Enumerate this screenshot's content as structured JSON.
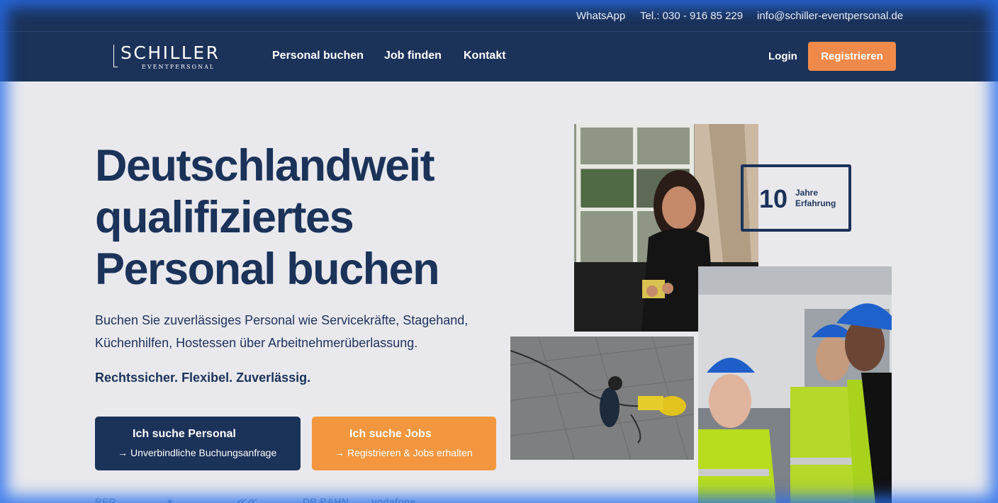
{
  "topbar": {
    "whatsapp": "WhatsApp",
    "phone": "Tel.: 030 - 916 85 229",
    "email": "info@schiller-eventpersonal.de"
  },
  "logo": {
    "main": "SCHILLER",
    "sub": "EVENTPERSONAL"
  },
  "nav": {
    "links": [
      "Personal buchen",
      "Job finden",
      "Kontakt"
    ],
    "login": "Login",
    "register": "Registrieren"
  },
  "hero": {
    "title_lines": [
      "Deutschlandweit",
      "qualifiziertes",
      "Personal buchen"
    ],
    "description": "Buchen Sie zuverlässiges Personal wie Servicekräfte, Stagehand, Küchenhilfen, Hostessen über Arbeitnehmerüberlassung.",
    "tagline": "Rechtssicher. Flexibel. Zuverlässig.",
    "cta_personal": {
      "title": "Ich suche Personal",
      "subtitle": "Unverbindliche Buchungsanfrage"
    },
    "cta_jobs": {
      "title": "Ich suche Jobs",
      "subtitle": "Registrieren & Jobs erhalten"
    }
  },
  "badge": {
    "number": "10",
    "line1": "Jahre",
    "line2": "Erfahrung"
  },
  "partners": [
    "BER",
    "DB BAHN",
    "vodafone"
  ],
  "colors": {
    "navy": "#1b3259",
    "orange_register": "#f08a4b",
    "orange_cta": "#f2973f",
    "background": "#e9e9ed"
  }
}
